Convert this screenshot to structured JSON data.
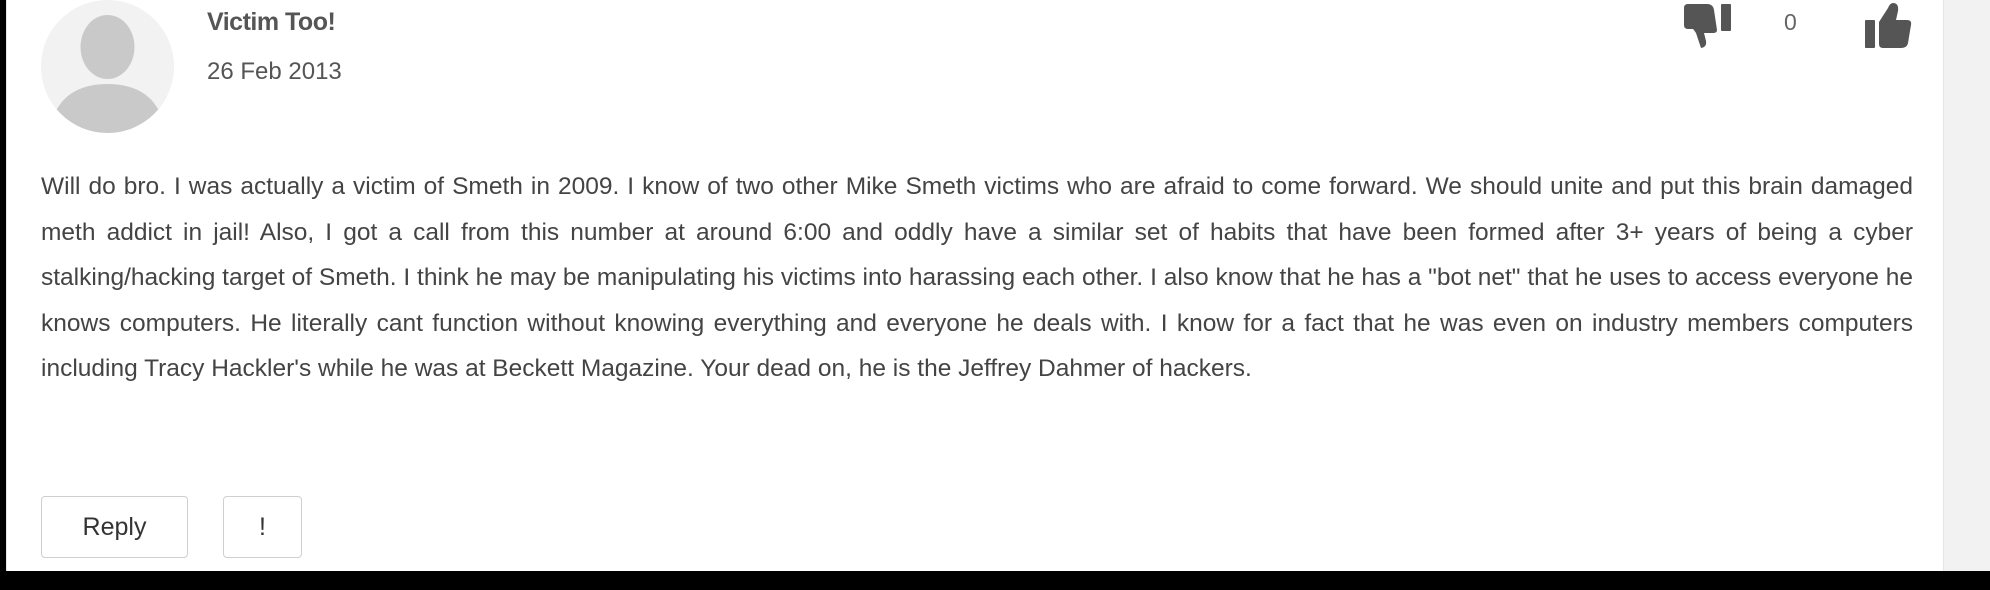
{
  "comment": {
    "author": "Victim Too!",
    "date": "26 Feb 2013",
    "vote_count": "0",
    "body": "Will do bro. I was actually a victim of Smeth in 2009. I know of two other Mike Smeth victims who are afraid to come forward. We should unite and put this brain damaged meth addict in jail! Also, I got a call from this number at around 6:00 and oddly have a similar set of habits that have been formed after 3+ years of being a cyber stalking/hacking target of Smeth. I think he may be manipulating his victims into harassing each other. I also know that he has a \"bot net\" that he uses to access everyone he knows computers. He literally cant function without knowing everything and everyone he deals with. I know for a fact that he was even on industry members computers including Tracy Hackler's while he was at Beckett Magazine. Your dead on, he is the Jeffrey Dahmer of hackers.",
    "actions": {
      "reply_label": "Reply",
      "report_label": "!"
    },
    "icons": {
      "avatar": "default-user-avatar-icon",
      "vote_down": "thumbs-down-icon",
      "vote_up": "thumbs-up-icon"
    }
  },
  "colors": {
    "background": "#000000",
    "card": "#ffffff",
    "icon": "#555555",
    "text": "#444444"
  }
}
